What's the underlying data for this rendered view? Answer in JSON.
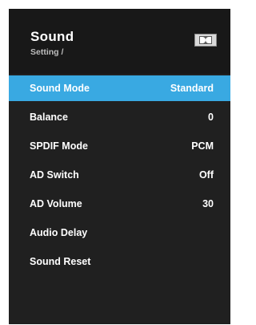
{
  "header": {
    "title": "Sound",
    "subtitle": "Setting /",
    "logo_icon": "dolby-double-d-icon"
  },
  "menu": {
    "items": [
      {
        "label": "Sound Mode",
        "value": "Standard",
        "selected": true
      },
      {
        "label": "Balance",
        "value": "0"
      },
      {
        "label": "SPDIF Mode",
        "value": "PCM"
      },
      {
        "label": "AD Switch",
        "value": "Off"
      },
      {
        "label": "AD Volume",
        "value": "30"
      },
      {
        "label": "Audio Delay",
        "value": ""
      },
      {
        "label": "Sound Reset",
        "value": ""
      }
    ]
  },
  "colors": {
    "panel": "#202020",
    "highlight": "#39a9e2",
    "text": "#ffffff"
  }
}
